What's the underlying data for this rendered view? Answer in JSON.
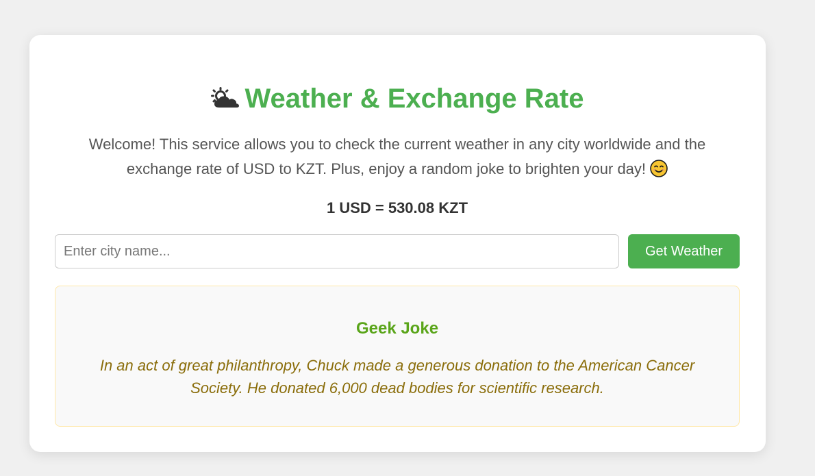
{
  "header": {
    "title": "Weather & Exchange Rate",
    "title_icon": "sun-behind-cloud-icon",
    "accent_color": "#4caf50"
  },
  "intro": {
    "text": "Welcome! This service allows you to check the current weather in any city worldwide and the exchange rate of USD to KZT. Plus, enjoy a random joke to brighten your day!",
    "emoji_icon": "smiling-face-icon"
  },
  "exchange": {
    "rate_text": "1 USD = 530.08 KZT"
  },
  "search": {
    "placeholder": "Enter city name...",
    "value": "",
    "button_label": "Get Weather"
  },
  "joke": {
    "heading": "Geek Joke",
    "text": "In an act of great philanthropy, Chuck made a generous donation to the American Cancer Society. He donated 6,000 dead bodies for scientific research."
  }
}
